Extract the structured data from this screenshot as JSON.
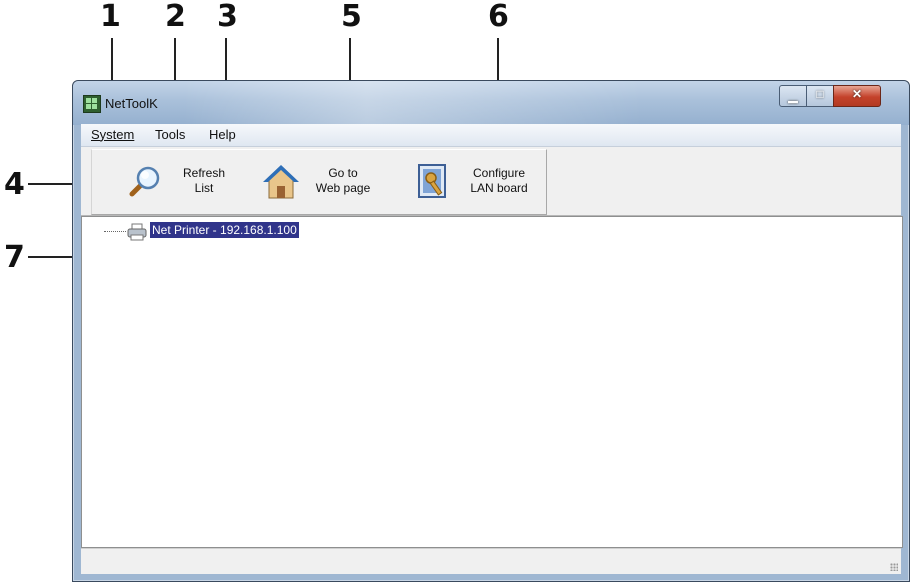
{
  "callouts": [
    "1",
    "2",
    "3",
    "4",
    "5",
    "6",
    "7"
  ],
  "window": {
    "title": "NetToolK"
  },
  "menu": {
    "system": "System",
    "tools": "Tools",
    "help": "Help"
  },
  "toolbar": {
    "refresh_line1": "Refresh",
    "refresh_line2": "List",
    "goto_line1": "Go to",
    "goto_line2": "Web page",
    "configure_line1": "Configure",
    "configure_line2": "LAN board"
  },
  "tree": {
    "device": "Net Printer - 192.168.1.100"
  },
  "icons": [
    "app-icon",
    "search-icon",
    "home-icon",
    "configure-icon",
    "printer-icon",
    "minimize-icon",
    "maximize-icon",
    "close-icon",
    "resize-grip-icon"
  ]
}
